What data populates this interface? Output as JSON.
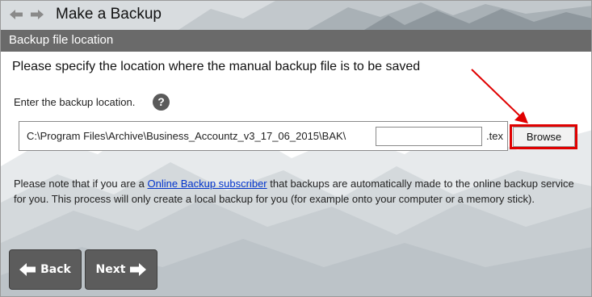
{
  "window": {
    "title": "Make a Backup",
    "nav_back_icon": "arrow-left-icon",
    "nav_forward_icon": "arrow-right-icon"
  },
  "section": {
    "title": "Backup file location"
  },
  "main": {
    "heading": "Please specify the location where the manual backup file is to be saved",
    "location_label": "Enter the backup location.",
    "help_icon": "?",
    "path": "C:\\Program Files\\Archive\\Business_Accountz_v3_17_06_2015\\BAK\\",
    "filename_value": "",
    "extension": ".tex",
    "browse_label": "Browse",
    "note_before": "Please note that if you are a ",
    "note_link": "Online Backup subscriber",
    "note_after": " that backups are automatically made to the online backup service for you. This process will only create a local backup for you (for example onto your computer or a memory stick)."
  },
  "footer": {
    "back_label": "Back",
    "next_label": "Next"
  },
  "colors": {
    "section_bar": "#6a6a6a",
    "highlight": "#e00000",
    "link": "#0033cc",
    "nav_button": "#5c5c5c"
  }
}
